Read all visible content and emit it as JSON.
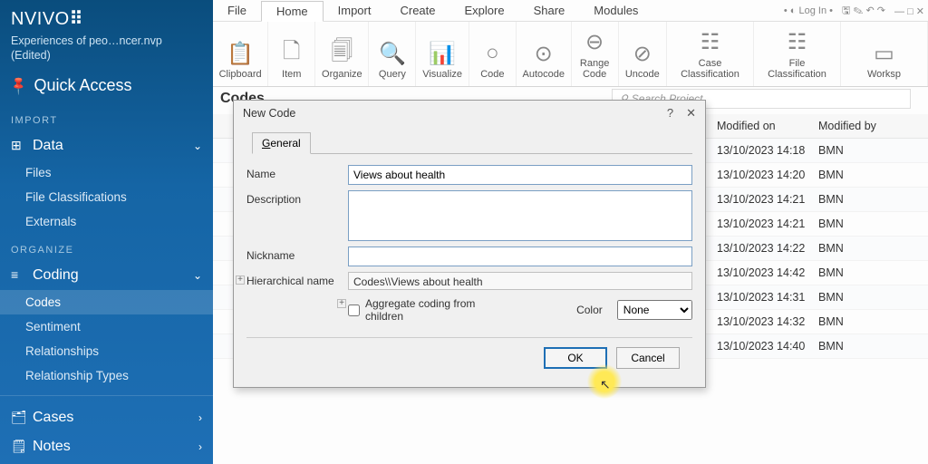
{
  "brand": "NVIVO",
  "project_name": "Experiences of peo…ncer.nvp",
  "project_status": "(Edited)",
  "quick_access": "Quick Access",
  "sections": {
    "import": "IMPORT",
    "organize": "ORGANIZE"
  },
  "nav": {
    "data": "Data",
    "data_items": [
      "Files",
      "File Classifications",
      "Externals"
    ],
    "coding": "Coding",
    "coding_items": [
      "Codes",
      "Sentiment",
      "Relationships",
      "Relationship Types"
    ],
    "cases": "Cases",
    "notes": "Notes"
  },
  "menu": {
    "items": [
      "File",
      "Home",
      "Import",
      "Create",
      "Explore",
      "Share",
      "Modules"
    ],
    "login": "Log In"
  },
  "ribbon": [
    {
      "glyph": "📋",
      "label": "Clipboard"
    },
    {
      "glyph": "🗋",
      "label": "Item"
    },
    {
      "glyph": "🗐",
      "label": "Organize"
    },
    {
      "glyph": "🔍",
      "label": "Query"
    },
    {
      "glyph": "📊",
      "label": "Visualize"
    },
    {
      "glyph": "○",
      "label": "Code"
    },
    {
      "glyph": "⊙",
      "label": "Autocode"
    },
    {
      "glyph": "⊖",
      "label": "Range Code"
    },
    {
      "glyph": "⊘",
      "label": "Uncode"
    },
    {
      "glyph": "☷",
      "label": "Case Classification"
    },
    {
      "glyph": "☷",
      "label": "File Classification"
    },
    {
      "glyph": "▭",
      "label": "Worksp"
    }
  ],
  "panel_title": "Codes",
  "search_placeholder": "Search Project",
  "grid": {
    "headers": {
      "modified_on": "Modified on",
      "modified_by": "Modified by"
    },
    "rows": [
      {
        "mod": "13/10/2023 14:18",
        "by": "BMN"
      },
      {
        "mod": "13/10/2023 14:20",
        "by": "BMN"
      },
      {
        "mod": "13/10/2023 14:21",
        "by": "BMN"
      },
      {
        "mod": "13/10/2023 14:21",
        "by": "BMN"
      },
      {
        "mod": "13/10/2023 14:22",
        "by": "BMN"
      },
      {
        "mod": "13/10/2023 14:42",
        "by": "BMN"
      },
      {
        "mod": "13/10/2023 14:31",
        "by": "BMN"
      },
      {
        "mod": "13/10/2023 14:32",
        "by": "BMN"
      },
      {
        "mod": "13/10/2023 14:40",
        "by": "BMN"
      }
    ]
  },
  "dialog": {
    "title": "New Code",
    "tab": "General",
    "labels": {
      "name": "Name",
      "description": "Description",
      "nickname": "Nickname",
      "hierarchical": "Hierarchical name",
      "aggregate": "Aggregate coding from children",
      "color": "Color"
    },
    "values": {
      "name": "Views about health",
      "hierarchical": "Codes\\\\Views about health",
      "color": "None"
    },
    "buttons": {
      "ok": "OK",
      "cancel": "Cancel"
    }
  }
}
